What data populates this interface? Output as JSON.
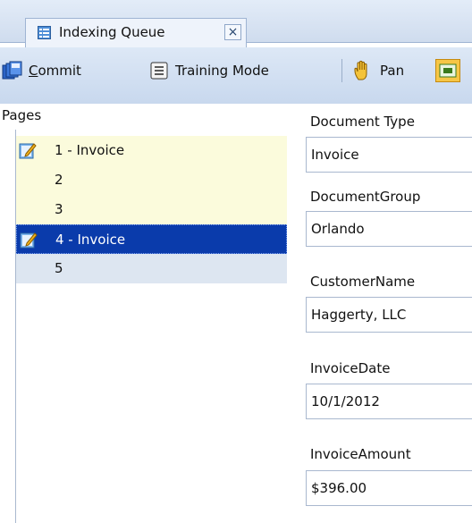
{
  "tab": {
    "title": "Indexing Queue",
    "close_glyph": "×"
  },
  "toolbar": {
    "commit_label_accesskey": "C",
    "commit_label_rest": "ommit",
    "training_label": "Training Mode",
    "pan_label": "Pan"
  },
  "pages": {
    "label": "Pages",
    "items": [
      {
        "label": "1 - Invoice",
        "icon": "document-edit-icon",
        "state": "document-1"
      },
      {
        "label": "2",
        "state": "document-1"
      },
      {
        "label": "3",
        "state": "document-1"
      },
      {
        "label": "4 - Invoice",
        "icon": "document-edit-icon",
        "state": "selected"
      },
      {
        "label": "5",
        "state": "document-2"
      }
    ]
  },
  "fields": [
    {
      "label": "Document Type",
      "value": "Invoice"
    },
    {
      "label": "DocumentGroup",
      "value": "Orlando"
    },
    {
      "label": "CustomerName",
      "value": "Haggerty, LLC"
    },
    {
      "label": "InvoiceDate",
      "value": "10/1/2012"
    },
    {
      "label": "InvoiceAmount",
      "value": "$396.00"
    }
  ],
  "colors": {
    "selection": "#0a3bab",
    "document_1_band": "#fbfbdc",
    "document_2_band": "#dde6f1",
    "toolbar": "#c8d8ee"
  }
}
